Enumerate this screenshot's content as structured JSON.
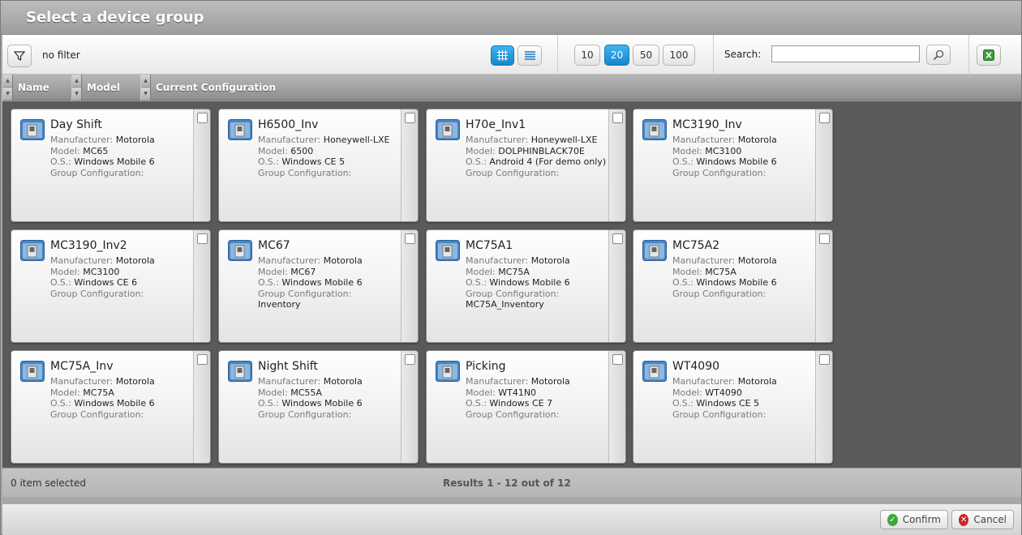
{
  "dialog": {
    "title": "Select a device group"
  },
  "toolbar": {
    "filter_text": "no filter",
    "page_sizes": [
      "10",
      "20",
      "50",
      "100"
    ],
    "active_page_size": "20",
    "search_label": "Search:",
    "search_value": "",
    "view_mode": "grid"
  },
  "columns": [
    "Name",
    "Model",
    "Current Configuration"
  ],
  "labels": {
    "manufacturer": "Manufacturer:",
    "model": "Model:",
    "os": "O.S.:",
    "group_config": "Group Configuration:"
  },
  "devices": [
    {
      "name": "Day Shift",
      "manufacturer": "Motorola",
      "model": "MC65",
      "os": "Windows Mobile 6",
      "group_config": ""
    },
    {
      "name": "H6500_Inv",
      "manufacturer": "Honeywell-LXE",
      "model": "6500",
      "os": "Windows CE 5",
      "group_config": ""
    },
    {
      "name": "H70e_Inv1",
      "manufacturer": "Honeywell-LXE",
      "model": "DOLPHINBLACK70E",
      "os": "Android 4 (For demo only)",
      "group_config": ""
    },
    {
      "name": "MC3190_Inv",
      "manufacturer": "Motorola",
      "model": "MC3100",
      "os": "Windows Mobile 6",
      "group_config": ""
    },
    {
      "name": "MC3190_Inv2",
      "manufacturer": "Motorola",
      "model": "MC3100",
      "os": "Windows CE 6",
      "group_config": ""
    },
    {
      "name": "MC67",
      "manufacturer": "Motorola",
      "model": "MC67",
      "os": "Windows Mobile 6",
      "group_config": "Inventory"
    },
    {
      "name": "MC75A1",
      "manufacturer": "Motorola",
      "model": "MC75A",
      "os": "Windows Mobile 6",
      "group_config": "MC75A_Inventory"
    },
    {
      "name": "MC75A2",
      "manufacturer": "Motorola",
      "model": "MC75A",
      "os": "Windows Mobile 6",
      "group_config": ""
    },
    {
      "name": "MC75A_Inv",
      "manufacturer": "Motorola",
      "model": "MC75A",
      "os": "Windows Mobile 6",
      "group_config": ""
    },
    {
      "name": "Night Shift",
      "manufacturer": "Motorola",
      "model": "MC55A",
      "os": "Windows Mobile 6",
      "group_config": ""
    },
    {
      "name": "Picking",
      "manufacturer": "Motorola",
      "model": "WT41N0",
      "os": "Windows CE 7",
      "group_config": ""
    },
    {
      "name": "WT4090",
      "manufacturer": "Motorola",
      "model": "WT4090",
      "os": "Windows CE 5",
      "group_config": ""
    }
  ],
  "status": {
    "selected": "0 item selected",
    "results": "Results 1 - 12 out of 12"
  },
  "footer": {
    "confirm": "Confirm",
    "cancel": "Cancel"
  }
}
